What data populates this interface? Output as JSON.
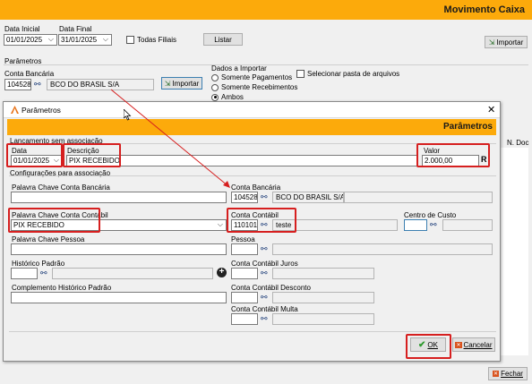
{
  "main": {
    "title": "Movimento Caixa",
    "data_inicial_label": "Data Inicial",
    "data_inicial_value": "01/01/2025",
    "data_final_label": "Data Final",
    "data_final_value": "31/01/2025",
    "todas_filiais_label": "Todas Filiais",
    "listar_label": "Listar",
    "importar_top_label": "Importar",
    "parametros_label": "Parâmetros",
    "conta_bancaria_label": "Conta Bancária",
    "conta_code": "104528",
    "conta_name": "BCO DO BRASIL S/A",
    "importar_label": "Importar",
    "dados_importar_label": "Dados a Importar",
    "radio_options": [
      "Somente Pagamentos",
      "Somente Recebimentos",
      "Ambos"
    ],
    "selecionar_pasta_label": "Selecionar pasta de arquivos",
    "n_doc_label": "N. Doc",
    "fechar_label": "Fechar"
  },
  "dialog": {
    "title": "Parâmetros",
    "header": "Parâmetros",
    "lancamento_label": "Lançamento sem associação",
    "data_label": "Data",
    "data_value": "01/01/2025",
    "descricao_label": "Descrição",
    "descricao_value": "PIX RECEBIDO",
    "valor_label": "Valor",
    "valor_value": "2.000,00",
    "r_label": "R",
    "config_label": "Configurações para associação",
    "palavra_conta_bancaria_label": "Palavra Chave Conta Bancária",
    "conta_bancaria_label": "Conta Bancária",
    "conta_bancaria_code": "104528",
    "conta_bancaria_name": "BCO DO BRASIL S/A",
    "palavra_conta_contabil_label": "Palavra Chave Conta Contábil",
    "palavra_conta_contabil_value": "PIX RECEBIDO",
    "conta_contabil_label": "Conta Contábil",
    "conta_contabil_code": "1101010",
    "conta_contabil_name": "teste",
    "centro_custo_label": "Centro de Custo",
    "palavra_pessoa_label": "Palavra Chave Pessoa",
    "pessoa_label": "Pessoa",
    "historico_label": "Histórico Padrão",
    "conta_juros_label": "Conta Contábil Juros",
    "complemento_label": "Complemento Histórico Padrão",
    "conta_desconto_label": "Conta Contábil Desconto",
    "conta_multa_label": "Conta Contábil Multa",
    "ok_label": "OK",
    "cancelar_label": "Cancelar"
  }
}
